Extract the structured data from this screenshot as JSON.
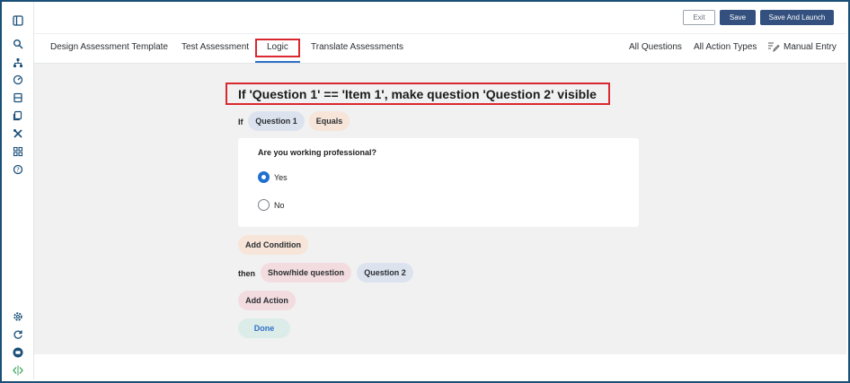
{
  "topbar": {
    "exit_label": "Exit",
    "save_label": "Save",
    "launch_label": "Save And Launch"
  },
  "tabs": [
    {
      "label": "Design Assessment Template"
    },
    {
      "label": "Test Assessment"
    },
    {
      "label": "Logic"
    },
    {
      "label": "Translate Assessments"
    }
  ],
  "right_menu": {
    "all_questions": "All Questions",
    "all_action_types": "All Action Types",
    "manual_entry": "Manual Entry"
  },
  "rule": {
    "summary": "If 'Question 1' == 'Item 1', make question 'Question 2' visible",
    "if_label": "If",
    "question_pill": "Question 1",
    "operator_pill": "Equals",
    "question_text": "Are you working professional?",
    "options": [
      "Yes",
      "No"
    ],
    "add_condition": "Add Condition",
    "then_label": "then",
    "action_pill": "Show/hide question",
    "target_pill": "Question 2",
    "add_action": "Add Action",
    "done": "Done"
  },
  "colors": {
    "accent": "#33507e",
    "highlight_border": "#d9282f",
    "radio_selected": "#1f6fd1"
  },
  "icons": {
    "rail_top": [
      "panel-toggle-icon",
      "search-icon",
      "sitemap-icon",
      "dashboard-icon",
      "database-icon",
      "stack-icon",
      "tools-icon",
      "apps-grid-icon",
      "help-icon"
    ],
    "rail_bottom": [
      "settings-icon",
      "refresh-icon",
      "chat-icon",
      "code-icon"
    ],
    "manual_entry": "pencil-lines-icon"
  }
}
